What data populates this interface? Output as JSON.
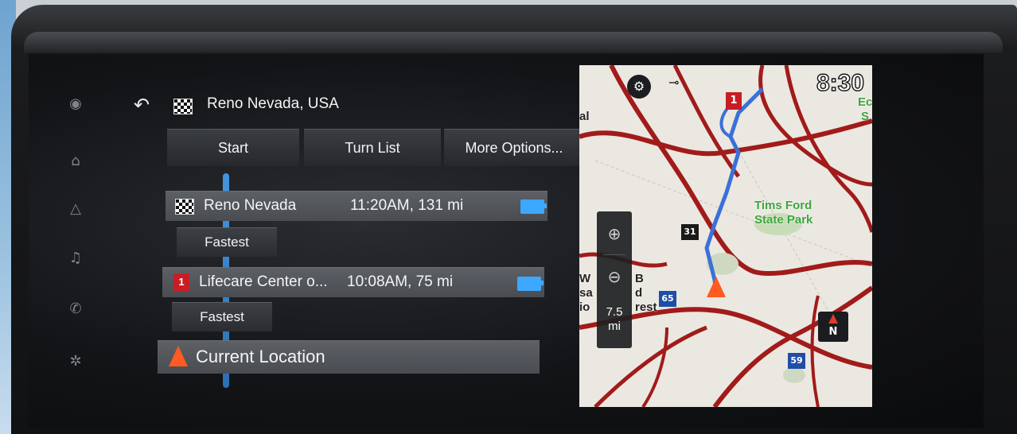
{
  "header": {
    "title": "Reno Nevada, USA"
  },
  "tabs": [
    {
      "label": "Start"
    },
    {
      "label": "Turn List"
    },
    {
      "label": "More Options..."
    }
  ],
  "route": {
    "stops": [
      {
        "name": "Reno Nevada",
        "eta": "11:20AM, 131 mi",
        "icon": "checkered-flag-icon"
      },
      {
        "name": "Lifecare Center o...",
        "eta": "10:08AM, 75 mi",
        "icon": "waypoint-flag-icon",
        "flag_number": "1"
      },
      {
        "name": "Current Location",
        "icon": "nav-arrow-icon"
      }
    ],
    "segments": [
      {
        "label": "Fastest"
      },
      {
        "label": "Fastest"
      }
    ]
  },
  "map": {
    "clock": "8:30",
    "zoom_in_icon": "zoom-in-icon",
    "zoom_out_icon": "zoom-out-icon",
    "scale_value": "7.5",
    "scale_unit": "mi",
    "compass_label": "N",
    "labels": [
      {
        "text": "Tims Ford"
      },
      {
        "text": "State Park"
      },
      {
        "text": "Ec"
      },
      {
        "text": "S"
      },
      {
        "text": "al"
      }
    ],
    "partial_labels": [
      {
        "text": "W"
      },
      {
        "text": "B"
      },
      {
        "text": "sa"
      },
      {
        "text": "d"
      },
      {
        "text": "io"
      },
      {
        "text": "rest"
      }
    ],
    "shields": [
      {
        "text": "31",
        "color": "#1a1a1a"
      },
      {
        "text": "65",
        "color": "#1f4ea8"
      },
      {
        "text": "59",
        "color": "#1f4ea8"
      }
    ],
    "flag_number": "1"
  },
  "colors": {
    "route_blue": "#3a70d8",
    "road_red": "#a11b1b",
    "accent_blue": "#3da8ff",
    "nav_orange": "#ff5a1f"
  }
}
